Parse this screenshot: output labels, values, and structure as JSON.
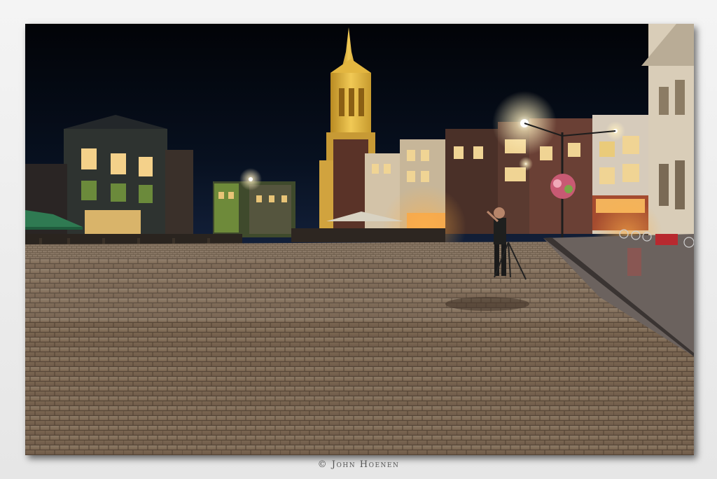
{
  "photo": {
    "subject": "night-town-square",
    "caption": "© John Hoenen"
  },
  "colors": {
    "sky": "#05070f",
    "tower": "#e7b83c",
    "cobble": "#7a6650",
    "lamp": "#fff4d0",
    "frame": "#ececec"
  }
}
